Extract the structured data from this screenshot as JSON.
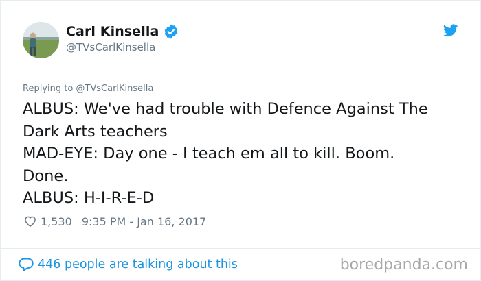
{
  "author": {
    "display_name": "Carl Kinsella",
    "handle": "@TVsCarlKinsella",
    "verified": true
  },
  "icons": {
    "verified": "verified-badge-icon",
    "brand": "twitter-bird-icon",
    "like": "heart-icon",
    "replies": "speech-bubble-icon"
  },
  "replying_to": "Replying to @TVsCarlKinsella",
  "tweet_lines": [
    "ALBUS: We've had trouble with Defence Against The",
    "Dark Arts teachers",
    "MAD-EYE: Day one - I teach em all to kill. Boom.",
    "Done.",
    "ALBUS: H-I-R-E-D"
  ],
  "like_count": "1,530",
  "timestamp": "9:35 PM - Jan 16, 2017",
  "conversation_link": "446 people are talking about this",
  "watermark": "boredpanda.com",
  "colors": {
    "accent": "#1da1f2",
    "link": "#1b95e0",
    "muted": "#657786",
    "text": "#14171a",
    "divider": "#e6ecf0"
  }
}
